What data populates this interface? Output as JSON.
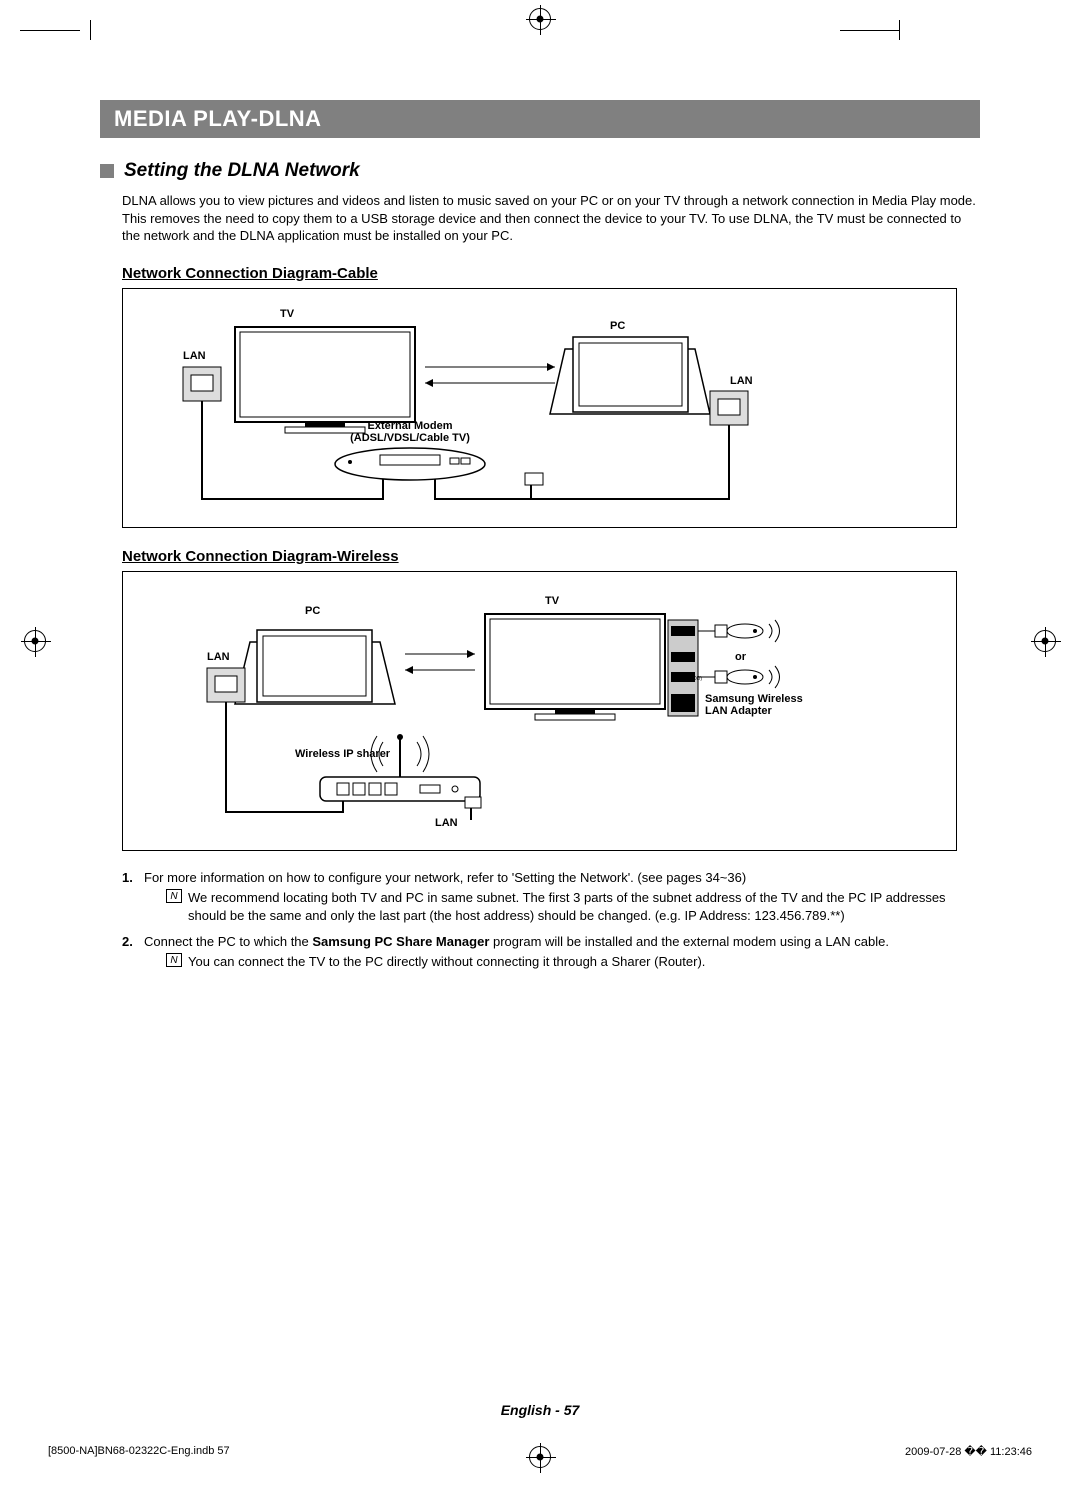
{
  "header": "MEDIA PLAY-DLNA",
  "section": {
    "title": "Setting the DLNA Network",
    "intro": "DLNA allows you to view pictures and videos and listen to music saved on your PC or on your TV through a network connection in Media Play mode. This removes the need to copy them to a USB storage device and then connect the device to your TV. To use DLNA, the TV must be connected to the network and the DLNA application must be installed on your PC."
  },
  "diagramCable": {
    "heading": "Network Connection Diagram-Cable",
    "labels": {
      "tv": "TV",
      "pc": "PC",
      "lan1": "LAN",
      "lan2": "LAN",
      "modem1": "External Modem",
      "modem2": "(ADSL/VDSL/Cable TV)"
    }
  },
  "diagramWireless": {
    "heading": "Network Connection Diagram-Wireless",
    "labels": {
      "tv": "TV",
      "pc": "PC",
      "lan_pc": "LAN",
      "lan_sharer": "LAN",
      "sharer": "Wireless IP sharer",
      "or": "or",
      "adapter1": "Samsung Wireless",
      "adapter2": "LAN Adapter"
    }
  },
  "notes": {
    "item1": {
      "num": "1.",
      "text": "For more information on how to configure your network, refer to 'Setting the Network'. (see pages 34~36)",
      "sub": "We recommend locating both TV and PC in same subnet. The first 3 parts of the subnet address of the TV and the PC IP addresses should be the same and only the last part (the host address) should be changed. (e.g. IP Address: 123.456.789.**)"
    },
    "item2": {
      "num": "2.",
      "text_a": "Connect the PC to which the ",
      "text_b": "Samsung PC Share Manager",
      "text_c": " program will be installed and the external modem using a LAN cable.",
      "sub": "You can connect the TV to the PC directly without connecting it through a Sharer (Router)."
    }
  },
  "footer": {
    "page": "English - 57",
    "file": "[8500-NA]BN68-02322C-Eng.indb   57",
    "timestamp": "2009-07-28   �� 11:23:46"
  }
}
